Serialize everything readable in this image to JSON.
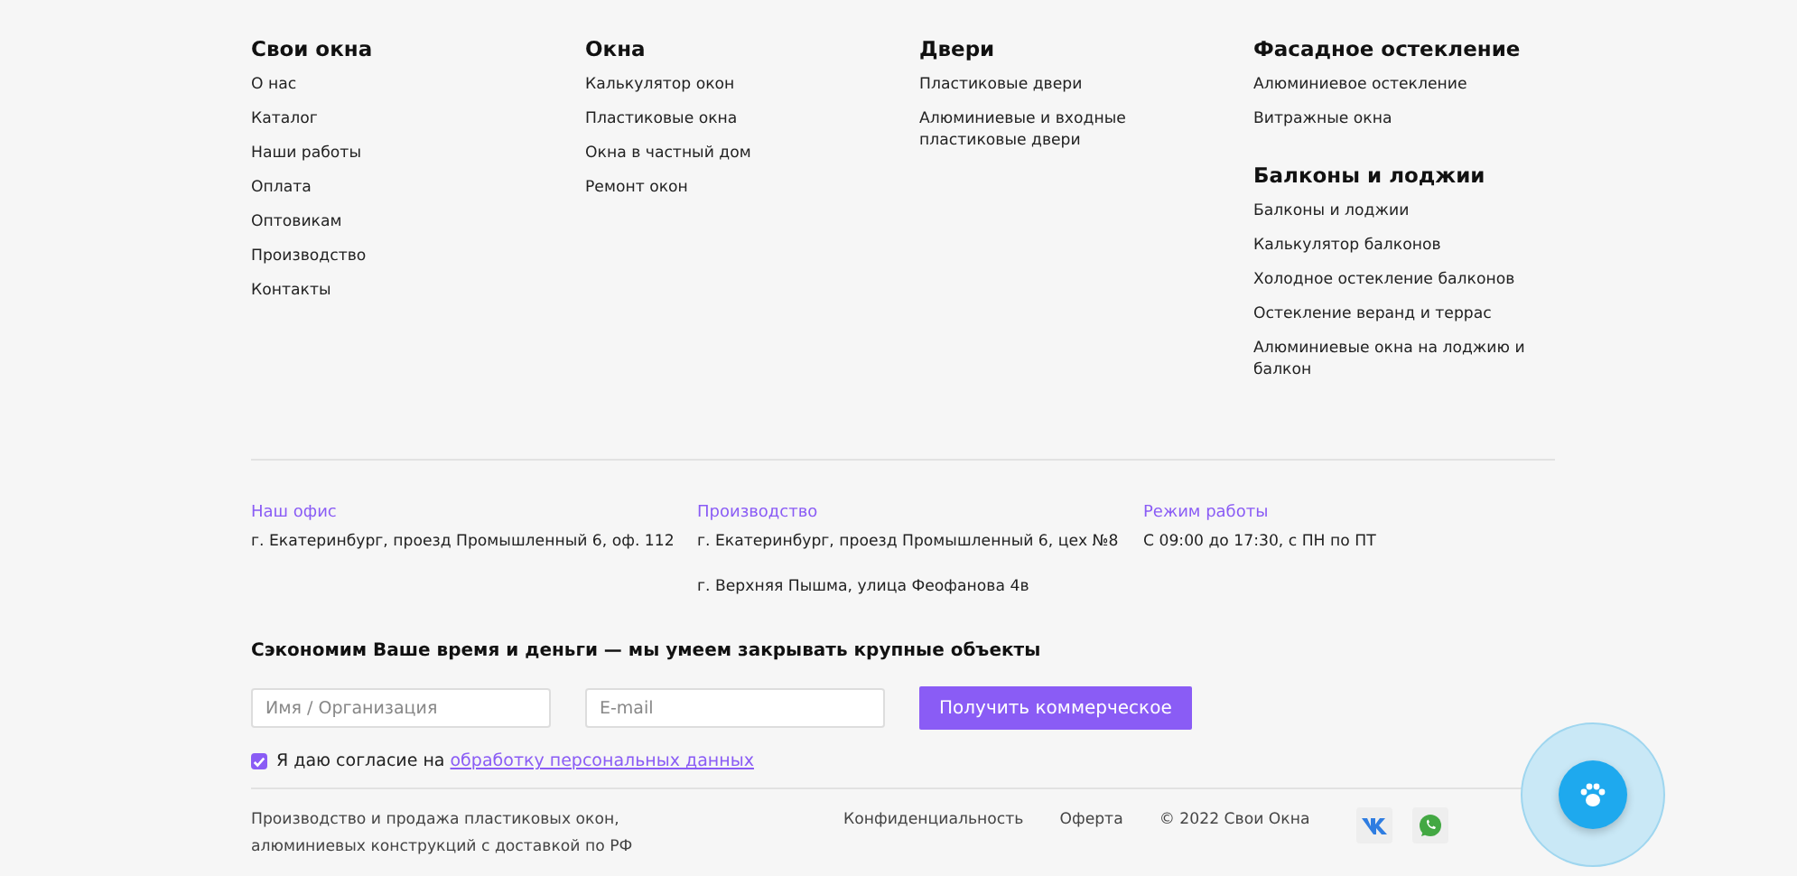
{
  "menu_columns": [
    {
      "groups": [
        {
          "title": "Свои окна",
          "links": [
            "О нас",
            "Каталог",
            "Наши работы",
            "Оплата",
            "Оптовикам",
            "Производство",
            "Контакты"
          ]
        }
      ]
    },
    {
      "groups": [
        {
          "title": "Окна",
          "links": [
            "Калькулятор окон",
            "Пластиковые окна",
            "Окна в частный дом",
            "Ремонт окон"
          ]
        }
      ]
    },
    {
      "groups": [
        {
          "title": "Двери",
          "links": [
            "Пластиковые двери",
            "Алюминиевые и входные пластиковые двери"
          ]
        }
      ]
    },
    {
      "groups": [
        {
          "title": "Фасадное остекление",
          "links": [
            "Алюминиевое остекление",
            "Витражные окна"
          ]
        },
        {
          "title": "Балконы и лоджии",
          "links": [
            "Балконы и лоджии",
            "Калькулятор балконов",
            "Холодное остекление балконов",
            "Остекление веранд и террас",
            "Алюминиевые окна на лоджию и балкон"
          ]
        }
      ]
    }
  ],
  "contacts": [
    {
      "label": "Наш офис",
      "lines": [
        "г. Екатеринбург, проезд Промышленный 6, оф. 112"
      ]
    },
    {
      "label": "Производство",
      "lines": [
        "г. Екатеринбург, проезд Промышленный 6, цех №8",
        "г. Верхняя Пышма, улица Феофанова 4в"
      ]
    },
    {
      "label": "Режим работы",
      "lines": [
        "С 09:00 до 17:30, с ПН по ПТ"
      ]
    }
  ],
  "form": {
    "heading": "Сэкономим Ваше время и деньги — мы умеем закрывать крупные объекты",
    "name_placeholder": "Имя / Организация",
    "email_placeholder": "E-mail",
    "submit": "Получить коммерческое",
    "consent_checked": true,
    "consent_text": "Я даю согласие на",
    "consent_link": "обработку персональных данных"
  },
  "bottom": {
    "description": "Производство и продажа пластиковых окон, алюминиевых конструкций с доставкой по РФ",
    "links": [
      "Конфиденциальность",
      "Оферта"
    ],
    "copyright": "© 2022 Свои Окна"
  }
}
